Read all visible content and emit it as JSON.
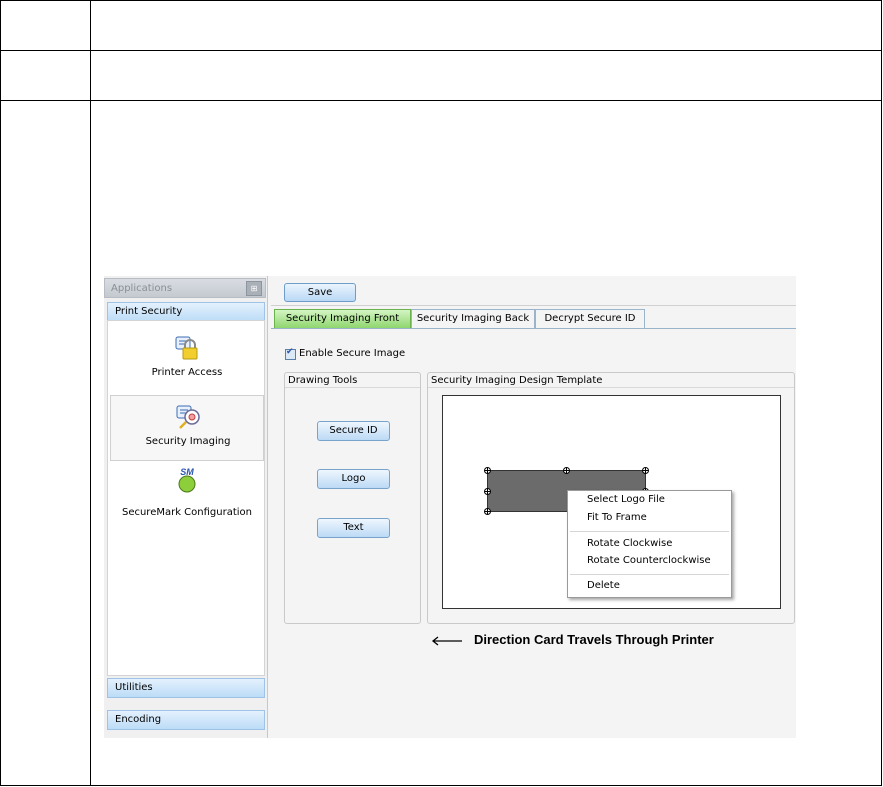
{
  "sidebar": {
    "header": "Applications",
    "pin_icon": "pin-icon",
    "group_print_security": "Print Security",
    "items": [
      {
        "label": "Printer Access",
        "icon": "lock-icon"
      },
      {
        "label": "Security Imaging",
        "icon": "security-imaging-icon"
      },
      {
        "label": "SecureMark Configuration",
        "icon": "securemark-icon",
        "badge": "SM"
      }
    ],
    "group_utilities": "Utilities",
    "group_encoding": "Encoding"
  },
  "toolbar": {
    "save_label": "Save"
  },
  "tabs": [
    {
      "label": "Security Imaging Front",
      "active": true
    },
    {
      "label": "Security Imaging Back",
      "active": false
    },
    {
      "label": "Decrypt Secure ID",
      "active": false
    }
  ],
  "enable_secure_image": {
    "label": "Enable Secure Image",
    "checked": true
  },
  "drawing_tools": {
    "title": "Drawing Tools",
    "buttons": [
      "Secure ID",
      "Logo",
      "Text"
    ]
  },
  "design_template": {
    "title": "Security Imaging Design Template"
  },
  "context_menu": {
    "items": [
      "Select Logo File",
      "Fit To Frame",
      "Rotate Clockwise",
      "Rotate Counterclockwise",
      "Delete"
    ]
  },
  "direction_text": "Direction Card Travels Through Printer",
  "colors": {
    "active_tab": "#8fd66e",
    "group_header": "#bcdcf7",
    "logo_fill": "#6b6b6b"
  }
}
